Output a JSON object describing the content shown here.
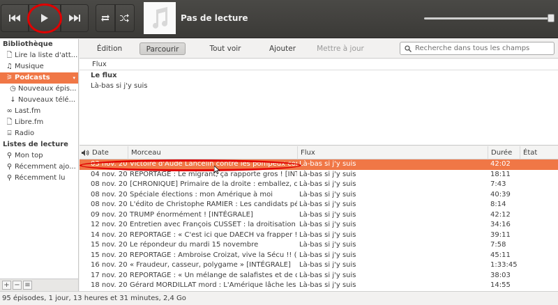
{
  "player": {
    "now_playing": "Pas de lecture"
  },
  "sidebar": {
    "library_heading": "Bibliothèque",
    "library_items": [
      {
        "label": "Lire la liste d'att...",
        "icon": "document-icon"
      },
      {
        "label": "Musique",
        "icon": "music-note-icon"
      },
      {
        "label": "Podcasts",
        "icon": "rss-icon"
      },
      {
        "label": "Nouveaux épis...",
        "icon": "clock-icon"
      },
      {
        "label": "Nouveaux télé...",
        "icon": "download-arrow-icon"
      },
      {
        "label": "Last.fm",
        "icon": "lastfm-icon"
      },
      {
        "label": "Libre.fm",
        "icon": "document-icon"
      },
      {
        "label": "Radio",
        "icon": "radio-icon"
      }
    ],
    "playlists_heading": "Listes de lecture",
    "playlist_items": [
      {
        "label": "Mon top",
        "icon": "search-icon"
      },
      {
        "label": "Récemment ajo...",
        "icon": "search-icon"
      },
      {
        "label": "Récemment lu",
        "icon": "search-icon"
      }
    ]
  },
  "nav": {
    "edit": "Édition",
    "browse": "Parcourir",
    "view_all": "Tout voir",
    "import": "Ajouter",
    "update": "Mettre à jour",
    "search_placeholder": "Recherche dans tous les champs"
  },
  "browser": {
    "column_header": "Flux",
    "all_label": "Le flux",
    "feeds": [
      "Là-bas si j'y suis"
    ]
  },
  "table": {
    "headers": {
      "date": "Date",
      "track": "Morceau",
      "feed": "Flux",
      "duration": "Durée",
      "status": "État"
    },
    "rows": [
      {
        "date": "03 nov. 201",
        "track": "Victoire d'Aude Lancelin contre les pompeux cor",
        "feed": "Là-bas si j'y suis",
        "duration": "42:02"
      },
      {
        "date": "04 nov. 201",
        "track": "REPORTAGE : Le migrant, ça rapporte gros ! [INT",
        "feed": "Là-bas si j'y suis",
        "duration": "18:11"
      },
      {
        "date": "08 nov. 201",
        "track": "[CHRONIQUE] Primaire de la droite : emballez, c'",
        "feed": "Là-bas si j'y suis",
        "duration": "7:43"
      },
      {
        "date": "08 nov. 201",
        "track": "Spéciale élections : mon Amérique à moi",
        "feed": "Là-bas si j'y suis",
        "duration": "40:39"
      },
      {
        "date": "08 nov. 201",
        "track": "L'édito de Christophe RAMIER : Les candidats pé",
        "feed": "Là-bas si j'y suis",
        "duration": "8:14"
      },
      {
        "date": "09 nov. 201",
        "track": "TRUMP énormément ! [INTÉGRALE]",
        "feed": "Là-bas si j'y suis",
        "duration": "42:12"
      },
      {
        "date": "12 nov. 201",
        "track": "Entretien avec François CUSSET : la droitisation",
        "feed": "Là-bas si j'y suis",
        "duration": "34:16"
      },
      {
        "date": "14 nov. 201",
        "track": "REPORTAGE : « C'est ici que DAECH va frapper ! ",
        "feed": "Là-bas si j'y suis",
        "duration": "39:11"
      },
      {
        "date": "15 nov. 201",
        "track": "Le répondeur du mardi 15 novembre",
        "feed": "Là-bas si j'y suis",
        "duration": "7:58"
      },
      {
        "date": "15 nov. 201",
        "track": "REPORTAGE : Ambroise Croizat, vive la Sécu !! (1",
        "feed": "Là-bas si j'y suis",
        "duration": "45:11"
      },
      {
        "date": "16 nov. 201",
        "track": "« Fraudeur, casseur, polygame » [INTÉGRALE]",
        "feed": "Là-bas si j'y suis",
        "duration": "1:33:45"
      },
      {
        "date": "17 nov. 201",
        "track": "REPORTAGE : « Un mélange de salafistes et de d",
        "feed": "Là-bas si j'y suis",
        "duration": "38:03"
      },
      {
        "date": "18 nov. 201",
        "track": "Gérard MORDILLAT mord : L'Amérique lâche les ",
        "feed": "Là-bas si j'y suis",
        "duration": "14:55"
      }
    ]
  },
  "status": "95 épisodes, 1 jour, 13 heures et 31 minutes, 2,4 Go",
  "colors": {
    "accent": "#f07746",
    "annotation": "#e00000",
    "toolbar": "#3f3e3b"
  }
}
